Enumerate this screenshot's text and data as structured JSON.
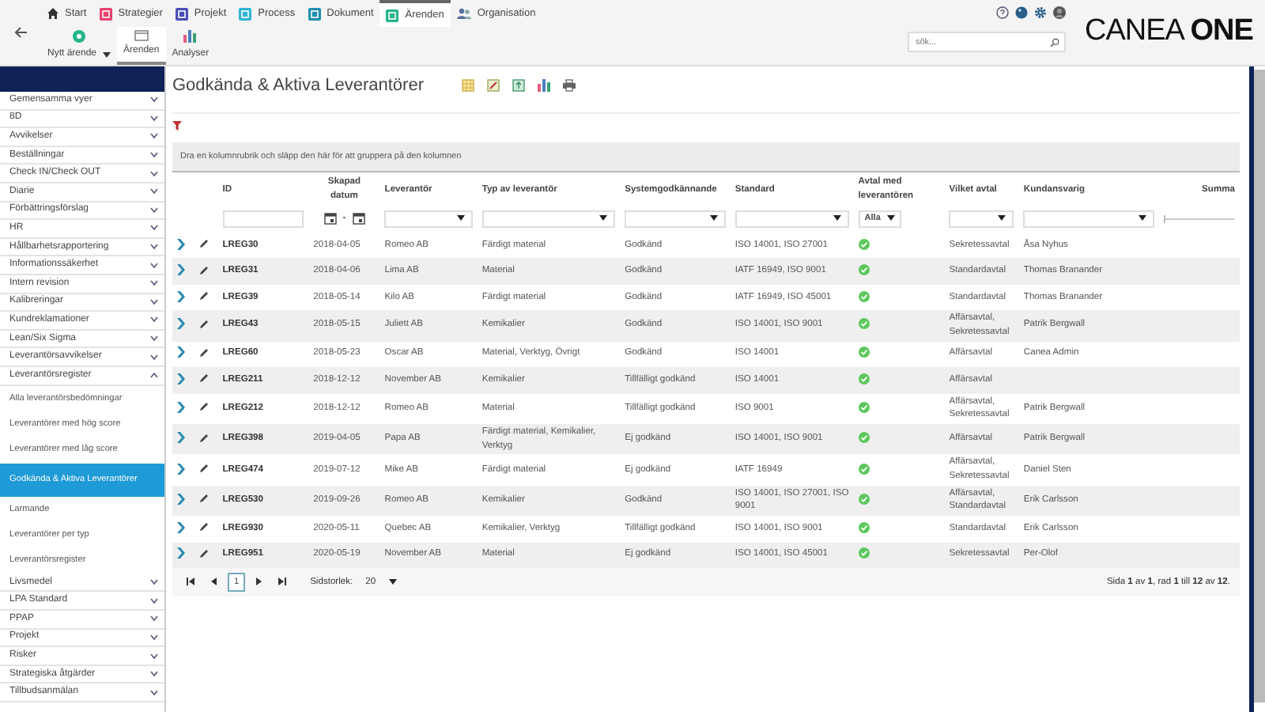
{
  "nav_tabs": [
    {
      "label": "Start",
      "kind": "house",
      "selected": false
    },
    {
      "label": "Strategier",
      "kind": "square",
      "color": "#e8426f",
      "selected": false
    },
    {
      "label": "Projekt",
      "kind": "square",
      "color": "#4a4fb8",
      "selected": false
    },
    {
      "label": "Process",
      "kind": "square",
      "color": "#2fb3d6",
      "selected": false
    },
    {
      "label": "Dokument",
      "kind": "square",
      "color": "#1f8fb0",
      "selected": false
    },
    {
      "label": "Ärenden",
      "kind": "square",
      "color": "#25b58a",
      "selected": true
    },
    {
      "label": "Organisation",
      "kind": "people",
      "selected": false
    }
  ],
  "toolbar": [
    {
      "label": "Nytt ärende",
      "kind": "new",
      "selected": false
    },
    {
      "label": "Ärenden",
      "kind": "list",
      "selected": true
    },
    {
      "label": "Analyser",
      "kind": "chart",
      "selected": false
    }
  ],
  "search": {
    "placeholder": "sök..."
  },
  "logo": {
    "text": "CANEA **ONE**"
  },
  "sidebar": {
    "items": [
      {
        "label": "Gemensamma vyer",
        "expanded": false
      },
      {
        "label": "8D",
        "expanded": false
      },
      {
        "label": "Avvikelser",
        "expanded": false
      },
      {
        "label": "Beställningar",
        "expanded": false
      },
      {
        "label": "Check IN/Check OUT",
        "expanded": false
      },
      {
        "label": "Diarie",
        "expanded": false
      },
      {
        "label": "Förbättringsförslag",
        "expanded": false
      },
      {
        "label": "HR",
        "expanded": false
      },
      {
        "label": "Hållbarhetsrapportering",
        "expanded": false
      },
      {
        "label": "Informationssäkerhet",
        "expanded": false
      },
      {
        "label": "Intern revision",
        "expanded": false
      },
      {
        "label": "Kalibreringar",
        "expanded": false
      },
      {
        "label": "Kundreklamationer",
        "expanded": false
      },
      {
        "label": "Lean/Six Sigma",
        "expanded": false
      },
      {
        "label": "Leverantörsavvikelser",
        "expanded": false
      },
      {
        "label": "Leverantörsregister",
        "expanded": true,
        "children": [
          {
            "label": "Alla leverantörsbedömningar",
            "selected": false
          },
          {
            "label": "Leverantörer med hög score",
            "selected": false
          },
          {
            "label": "Leverantörer med låg score",
            "selected": false
          },
          {
            "label": "Godkända & Aktiva Leverantörer",
            "selected": true
          },
          {
            "label": "Larmande",
            "selected": false
          },
          {
            "label": "Leverantörer per typ",
            "selected": false
          },
          {
            "label": "Leverantörsregister",
            "selected": false
          }
        ]
      },
      {
        "label": "Livsmedel",
        "expanded": false
      },
      {
        "label": "LPA Standard",
        "expanded": false
      },
      {
        "label": "PPAP",
        "expanded": false
      },
      {
        "label": "Projekt",
        "expanded": false
      },
      {
        "label": "Risker",
        "expanded": false
      },
      {
        "label": "Strategiska åtgärder",
        "expanded": false
      },
      {
        "label": "Tillbudsanmälan",
        "expanded": false
      }
    ]
  },
  "page": {
    "title": "Godkända & Aktiva Leverantörer",
    "group_hint": "Dra en kolumnrubrik och släpp den här för att gruppera på den kolumnen"
  },
  "table": {
    "columns": [
      "ID",
      "Skapad datum",
      "Leverantör",
      "Typ av leverantör",
      "Systemgodkännande",
      "Standard",
      "Avtal med leverantören",
      "Vilket avtal",
      "Kundansvarig",
      "Summa"
    ],
    "filters": [
      {
        "kind": "text"
      },
      {
        "kind": "date_range",
        "separator": "-"
      },
      {
        "kind": "dropdown"
      },
      {
        "kind": "dropdown"
      },
      {
        "kind": "dropdown"
      },
      {
        "kind": "dropdown"
      },
      {
        "kind": "select",
        "value": "Alla"
      },
      {
        "kind": "dropdown"
      },
      {
        "kind": "dropdown"
      },
      {
        "kind": "range"
      }
    ],
    "rows": [
      {
        "id": "LREG30",
        "created": "2018-04-05",
        "supplier": "Romeo AB",
        "type": "Färdigt material",
        "approval": "Godkänd",
        "standard": "ISO 14001, ISO 27001",
        "agreement": true,
        "contract": "Sekretessavtal",
        "manager": "Åsa Nyhus"
      },
      {
        "id": "LREG31",
        "created": "2018-04-06",
        "supplier": "Lima AB",
        "type": "Material",
        "approval": "Godkänd",
        "standard": "IATF 16949, ISO 9001",
        "agreement": true,
        "contract": "Standardavtal",
        "manager": "Thomas Branander"
      },
      {
        "id": "LREG39",
        "created": "2018-05-14",
        "supplier": "Kilo AB",
        "type": "Färdigt material",
        "approval": "Godkänd",
        "standard": "IATF 16949, ISO 45001",
        "agreement": true,
        "contract": "Standardavtal",
        "manager": "Thomas Branander"
      },
      {
        "id": "LREG43",
        "created": "2018-05-15",
        "supplier": "Juliett AB",
        "type": "Kemikalier",
        "approval": "Godkänd",
        "standard": "ISO 14001, ISO 9001",
        "agreement": true,
        "contract": "Affärsavtal, Sekretessavtal",
        "manager": "Patrik Bergwall"
      },
      {
        "id": "LREG60",
        "created": "2018-05-23",
        "supplier": "Oscar AB",
        "type": "Material, Verktyg, Övrigt",
        "approval": "Godkänd",
        "standard": "ISO 14001",
        "agreement": true,
        "contract": "Affärsavtal",
        "manager": "Canea Admin"
      },
      {
        "id": "LREG211",
        "created": "2018-12-12",
        "supplier": "November AB",
        "type": "Kemikalier",
        "approval": "Tillfälligt godkänd",
        "standard": "ISO 14001",
        "agreement": true,
        "contract": "Affärsavtal"
      },
      {
        "id": "LREG212",
        "created": "2018-12-12",
        "supplier": "Romeo AB",
        "type": "Material",
        "approval": "Tillfälligt godkänd",
        "standard": "ISO 9001",
        "agreement": true,
        "contract": "Affärsavtal, Sekretessavtal",
        "manager": "Patrik Bergwall"
      },
      {
        "id": "LREG398",
        "created": "2019-04-05",
        "supplier": "Papa AB",
        "type": "Färdigt material, Kemikalier, Verktyg",
        "approval": "Ej godkänd",
        "standard": "ISO 14001, ISO 9001",
        "agreement": true,
        "contract": "Affärsavtal",
        "manager": "Patrik Bergwall"
      },
      {
        "id": "LREG474",
        "created": "2019-07-12",
        "supplier": "Mike AB",
        "type": "Färdigt material",
        "approval": "Ej godkänd",
        "standard": "IATF 16949",
        "agreement": true,
        "contract": "Affärsavtal, Sekretessavtal",
        "manager": "Daniel Sten"
      },
      {
        "id": "LREG530",
        "created": "2019-09-26",
        "supplier": "Romeo AB",
        "type": "Kemikalier",
        "approval": "Godkänd",
        "standard": "ISO 14001, ISO 27001, ISO 9001",
        "agreement": true,
        "contract": "Affärsavtal, Standardavtal",
        "manager": "Erik Carlsson"
      },
      {
        "id": "LREG930",
        "created": "2020-05-11",
        "supplier": "Quebec AB",
        "type": "Kemikalier, Verktyg",
        "approval": "Tillfälligt godkänd",
        "standard": "ISO 14001, ISO 9001",
        "agreement": true,
        "contract": "Standardavtal",
        "manager": "Erik Carlsson"
      },
      {
        "id": "LREG951",
        "created": "2020-05-19",
        "supplier": "November AB",
        "type": "Material",
        "approval": "Ej godkänd",
        "standard": "ISO 14001, ISO 45001",
        "agreement": true,
        "contract": "Sekretessavtal",
        "manager": "Per-Olof"
      }
    ]
  },
  "pager": {
    "pages": [
      {
        "label": "1",
        "selected": true
      }
    ],
    "page_size_label": "Sidstorlek:",
    "page_size": "20",
    "summary": "Sida **1** av **1**, rad **1** till **12** av **12**."
  }
}
